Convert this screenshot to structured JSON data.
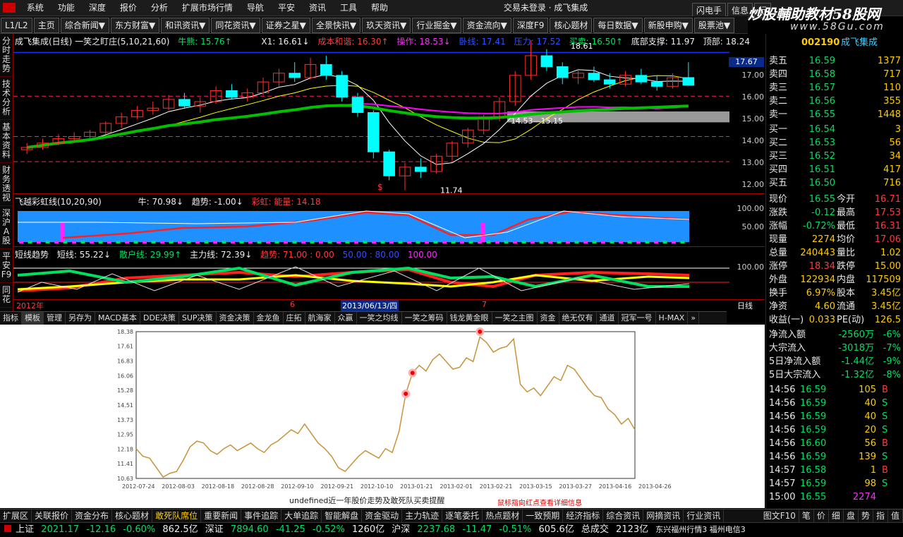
{
  "menu": {
    "items": [
      "系统",
      "功能",
      "深度",
      "报价",
      "分析",
      "扩展市场行情",
      "导航",
      "平安",
      "资讯",
      "工具",
      "帮助"
    ],
    "warning": "交易未登录 · 成飞集成",
    "right": [
      "闪电手",
      "信息",
      "行"
    ]
  },
  "watermark": {
    "line1": "炒股輔助教材58股网",
    "line2": "www.58Gu.com"
  },
  "toolbar": {
    "items": [
      "L1/L2",
      "主页",
      "综合新闻▼",
      "东方财富▼",
      "和讯资讯▼",
      "同花资讯▼",
      "证券之星▼",
      "全景快讯▼",
      "玖天资讯▼",
      "行业掘金▼",
      "资金流向▼",
      "深度F9",
      "核心题材",
      "每日数据▼",
      "新股申购▼",
      "股票池▼",
      "股指期货",
      "全球指"
    ]
  },
  "sidetabs": [
    "分时走势",
    "技术分析",
    "基本资料",
    "财务透视",
    "深沪A股",
    "平安F9",
    "同花"
  ],
  "main_chart": {
    "title": "成飞集成(日线) 一笑之盯庄(5,10,21,60)",
    "niu": "牛熊: 15.76↑",
    "x1": "X1: 16.61↓",
    "cost": "成本和谐: 16.30↑",
    "op": "操作: 18.53↓",
    "sk1": "卧线: 17.41",
    "sk2": "压力: 17.52",
    "buysell": "买卖: 16.50↑",
    "support": "底部支撑: 11.97",
    "top": "顶部: 18.24",
    "peak_label": "18.61",
    "low_label": "11.74",
    "mid_label": "14.53—15.15",
    "cursor_price": "17.67",
    "y_ticks": [
      "17.00",
      "16.00",
      "15.00",
      "14.00",
      "13.00",
      "12.00"
    ],
    "icon": "$",
    "colors": {
      "up": "#ff3030",
      "down": "#00ffff",
      "ma5": "#ffffff",
      "ma10": "#ffff00",
      "ma21": "#ff00ff",
      "ma60": "#00c000"
    }
  },
  "candles": [
    [
      13.6,
      13.9,
      13.4,
      13.7
    ],
    [
      13.7,
      14.1,
      13.6,
      13.9
    ],
    [
      13.9,
      14.3,
      13.8,
      14.1
    ],
    [
      14.1,
      14.4,
      13.9,
      14.2
    ],
    [
      14.2,
      14.5,
      14.0,
      14.4
    ],
    [
      14.4,
      14.9,
      14.3,
      14.8
    ],
    [
      14.8,
      15.3,
      14.6,
      15.1
    ],
    [
      15.1,
      15.6,
      15.0,
      15.4
    ],
    [
      15.4,
      15.8,
      15.2,
      15.5
    ],
    [
      15.5,
      16.1,
      15.4,
      15.9
    ],
    [
      15.9,
      16.2,
      15.5,
      15.6
    ],
    [
      15.6,
      16.0,
      15.3,
      15.8
    ],
    [
      15.8,
      16.5,
      15.7,
      16.3
    ],
    [
      16.3,
      16.6,
      15.9,
      16.0
    ],
    [
      16.0,
      16.4,
      15.8,
      16.2
    ],
    [
      16.2,
      16.9,
      16.1,
      16.7
    ],
    [
      16.7,
      17.3,
      16.5,
      17.1
    ],
    [
      17.1,
      17.6,
      16.7,
      16.9
    ],
    [
      16.9,
      17.8,
      16.8,
      17.5
    ],
    [
      17.5,
      17.9,
      16.8,
      17.0
    ],
    [
      17.0,
      17.2,
      15.8,
      16.0
    ],
    [
      16.0,
      16.2,
      15.1,
      15.3
    ],
    [
      15.3,
      15.4,
      13.2,
      13.5
    ],
    [
      13.5,
      13.6,
      12.2,
      12.4
    ],
    [
      12.4,
      13.0,
      11.74,
      12.8
    ],
    [
      12.8,
      13.2,
      12.3,
      12.6
    ],
    [
      12.6,
      13.4,
      12.5,
      13.3
    ],
    [
      13.3,
      14.0,
      13.1,
      13.9
    ],
    [
      13.9,
      14.6,
      13.7,
      14.5
    ],
    [
      14.5,
      15.2,
      14.3,
      15.1
    ],
    [
      15.1,
      16.0,
      14.9,
      15.8
    ],
    [
      15.8,
      17.2,
      15.6,
      17.0
    ],
    [
      17.0,
      18.61,
      16.8,
      17.9
    ],
    [
      17.9,
      18.2,
      17.2,
      17.4
    ],
    [
      17.4,
      17.6,
      16.6,
      16.9
    ],
    [
      16.9,
      17.3,
      16.6,
      17.1
    ],
    [
      17.1,
      17.4,
      16.7,
      16.8
    ],
    [
      16.8,
      17.1,
      16.4,
      16.6
    ],
    [
      16.6,
      17.2,
      16.5,
      17.0
    ],
    [
      17.0,
      17.3,
      16.6,
      16.7
    ],
    [
      16.7,
      17.0,
      16.3,
      16.5
    ],
    [
      16.5,
      17.1,
      16.4,
      16.9
    ],
    [
      16.9,
      17.6,
      16.8,
      16.55
    ]
  ],
  "osc_chart": {
    "title": "飞越彩虹线(10,20,90)",
    "niu": "牛: 70.98↓",
    "trend": "趋势: -1.00↓",
    "rainbow": "彩虹: 能量: 14.18",
    "y_ticks": [
      "100.00",
      "50.00"
    ]
  },
  "trend_chart": {
    "title": "短线趋势",
    "short": "短线: 55.22↓",
    "retail": "散户线: 29.99↑",
    "main": "主力线: 72.39↓",
    "trend": "趋势: 71.00 : 0.00",
    "tail": "50.00 : 80.00",
    "hundred": "100.00",
    "y_ticks": [
      "100.00"
    ]
  },
  "date_axis": {
    "left": "2012年",
    "mark1": "6",
    "cursor": "2013/06/13/四",
    "mark2": "7",
    "period": "日线"
  },
  "bottom_tabs": [
    "指标",
    "模板",
    "管理",
    "另存为",
    "MACD基本",
    "DDE决策",
    "SUP决策",
    "资金决策",
    "金龙鱼",
    "庄拓",
    "航海家",
    "众赢",
    "一笑之均线",
    "一笑之筹码",
    "钱龙黄金眼",
    "一笑之主图",
    "资金",
    "绝无仅有",
    "通道",
    "冠军一号",
    "H-MAX",
    "»"
  ],
  "line_chart": {
    "y_ticks": [
      "18.38",
      "17.61",
      "16.83",
      "16.06",
      "15.28",
      "14.51",
      "13.73",
      "12.95",
      "12.18",
      "11.41",
      "10.63"
    ],
    "x_ticks": [
      "2012-07-24",
      "2012-08-03",
      "2012-08-18",
      "2012-08-28",
      "2012-09-10",
      "2012-09-21",
      "2012-10-10",
      "2013-01-21",
      "2013-02-01",
      "2013-02-21",
      "2013-03-15",
      "2013-03-27",
      "2013-04-16",
      "2013-04-26"
    ],
    "caption": "undefined近一年股价走势及敢死队买卖提醒",
    "note": "鼠标指向红点查看详细信息",
    "line_color": "#c8923a",
    "values": [
      12.2,
      11.8,
      11.7,
      11.2,
      10.7,
      10.9,
      11.0,
      11.6,
      12.3,
      12.6,
      12.5,
      12.1,
      11.9,
      12.2,
      12.4,
      12.1,
      12.3,
      12.5,
      12.2,
      12.0,
      12.4,
      12.6,
      12.9,
      13.2,
      13.0,
      13.5,
      13.0,
      12.5,
      12.2,
      11.8,
      11.2,
      11.0,
      11.4,
      11.8,
      12.1,
      11.9,
      11.7,
      12.2,
      12.0,
      13.1,
      15.1,
      16.2,
      16.6,
      16.3,
      16.9,
      17.2,
      16.8,
      16.4,
      16.5,
      17.0,
      16.8,
      18.1,
      17.8,
      17.3,
      17.5,
      17.6,
      18.0,
      15.6,
      15.2,
      15.4,
      15.0,
      15.5,
      16.0,
      15.8,
      16.6,
      16.4,
      15.9,
      15.4,
      15.0,
      14.9,
      14.3,
      14.0,
      13.5,
      13.8,
      13.2
    ],
    "red_points": [
      [
        40,
        15.1
      ],
      [
        41,
        16.2
      ],
      [
        51,
        18.38
      ]
    ]
  },
  "quote": {
    "code": "002190",
    "name": "成飞集成",
    "asks": [
      [
        "卖五",
        "16.59",
        "1377"
      ],
      [
        "卖四",
        "16.58",
        "717"
      ],
      [
        "卖三",
        "16.57",
        "110"
      ],
      [
        "卖二",
        "16.56",
        "355"
      ],
      [
        "卖一",
        "16.55",
        "1448"
      ]
    ],
    "bids": [
      [
        "买一",
        "16.54",
        "3"
      ],
      [
        "买二",
        "16.53",
        "56"
      ],
      [
        "买三",
        "16.52",
        "34"
      ],
      [
        "买四",
        "16.51",
        "417"
      ],
      [
        "买五",
        "16.50",
        "716"
      ]
    ],
    "stats": [
      [
        "现价",
        "16.55",
        "今开",
        "16.71"
      ],
      [
        "涨跌",
        "-0.12",
        "最高",
        "17.53"
      ],
      [
        "涨幅",
        "-0.72%",
        "最低",
        "16.31"
      ],
      [
        "现量",
        "2274",
        "均价",
        "17.06"
      ],
      [
        "总量",
        "240443",
        "量比",
        "1.02"
      ],
      [
        "涨停",
        "18.34",
        "跌停",
        "15.00"
      ],
      [
        "外盘",
        "122934",
        "内盘",
        "117509"
      ],
      [
        "换手",
        "6.97%",
        "股本",
        "3.45亿"
      ],
      [
        "净资",
        "4.60",
        "流通",
        "3.45亿"
      ],
      [
        "收益(一)",
        "0.033",
        "PE(动)",
        "126.5"
      ]
    ],
    "flows": [
      [
        "净流入额",
        "-2560万",
        "-6%"
      ],
      [
        "大宗流入",
        "-3018万",
        "-7%"
      ],
      [
        "5日净流入额",
        "-1.44亿",
        "-9%"
      ],
      [
        "5日大宗流入",
        "-1.32亿",
        "-8%"
      ]
    ],
    "ticks": [
      [
        "14:56",
        "16.59",
        "105",
        "B"
      ],
      [
        "14:56",
        "16.59",
        "40",
        "S"
      ],
      [
        "14:56",
        "16.59",
        "40",
        "S"
      ],
      [
        "14:56",
        "16.59",
        "20",
        "S"
      ],
      [
        "14:56",
        "16.60",
        "56",
        "B"
      ],
      [
        "14:56",
        "16.59",
        "139",
        "S"
      ],
      [
        "14:57",
        "16.58",
        "1",
        "B"
      ],
      [
        "14:57",
        "16.59",
        "98",
        "S"
      ],
      [
        "15:00",
        "16.55",
        "2274",
        ""
      ]
    ]
  },
  "links_bar": [
    "扩展区",
    "关联报价",
    "资金分布",
    "核心题材",
    "敢死队席位",
    "重要新闻",
    "事件追踪",
    "大单追踪",
    "智能解盘",
    "资金驱动",
    "主力轨迹",
    "逐笔委托",
    "热点题材",
    "一致预期",
    "经济指标",
    "综合资讯",
    "网摘资讯",
    "行业资讯"
  ],
  "links_right": [
    "图文F10",
    "笔",
    "价",
    "细",
    "盘",
    "势",
    "指",
    "值"
  ],
  "status": {
    "sh_label": "上证",
    "sh_val": "2021.17",
    "sh_chg": "-12.16",
    "sh_pct": "-0.60%",
    "sh_amt": "862.5亿",
    "sz_label": "深证",
    "sz_val": "7894.60",
    "sz_chg": "-41.25",
    "sz_pct": "-0.52%",
    "sz_amt": "1260亿",
    "hs_label": "沪深",
    "hs_val": "2237.68",
    "hs_chg": "-11.47",
    "hs_pct": "-0.51%",
    "hs_amt": "605.6亿",
    "total_label": "总成交",
    "total_val": "2123亿",
    "server": "东兴福州行情3 福州电信3"
  }
}
